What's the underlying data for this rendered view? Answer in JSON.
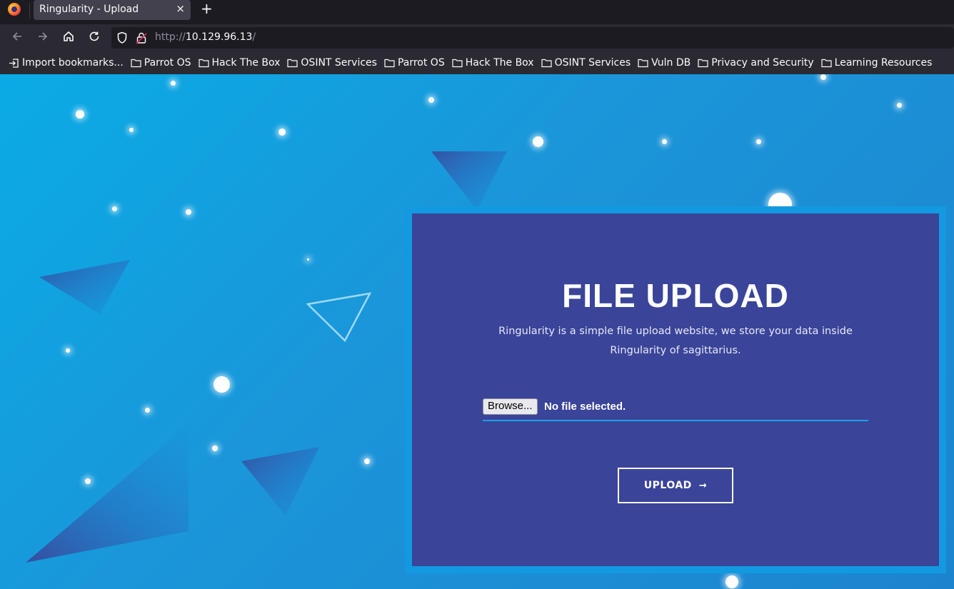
{
  "browser": {
    "tab_title": "Ringularity - Upload",
    "tab_close": "×",
    "new_tab": "+",
    "url_scheme": "http://",
    "url_host": "10.129.96.13",
    "url_path": "/",
    "bookmarks": [
      {
        "label": "Import bookmarks...",
        "icon": "import-icon"
      },
      {
        "label": "Parrot OS",
        "icon": "folder-icon"
      },
      {
        "label": "Hack The Box",
        "icon": "folder-icon"
      },
      {
        "label": "OSINT Services",
        "icon": "folder-icon"
      },
      {
        "label": "Parrot OS",
        "icon": "folder-icon"
      },
      {
        "label": "Hack The Box",
        "icon": "folder-icon"
      },
      {
        "label": "OSINT Services",
        "icon": "folder-icon"
      },
      {
        "label": "Vuln DB",
        "icon": "folder-icon"
      },
      {
        "label": "Privacy and Security",
        "icon": "folder-icon"
      },
      {
        "label": "Learning Resources",
        "icon": "folder-icon"
      }
    ]
  },
  "upload": {
    "title": "FILE UPLOAD",
    "description": "Ringularity is a simple file upload website, we store your data inside Ringularity of sagittarius.",
    "browse_label": "Browse...",
    "file_status": "No file selected.",
    "upload_label": "UPLOAD",
    "upload_arrow": "→"
  },
  "colors": {
    "page_gradient_start": "#0aabe6",
    "page_gradient_end": "#1c84cf",
    "card_background": "#3a4499",
    "card_border": "#1399e0"
  }
}
